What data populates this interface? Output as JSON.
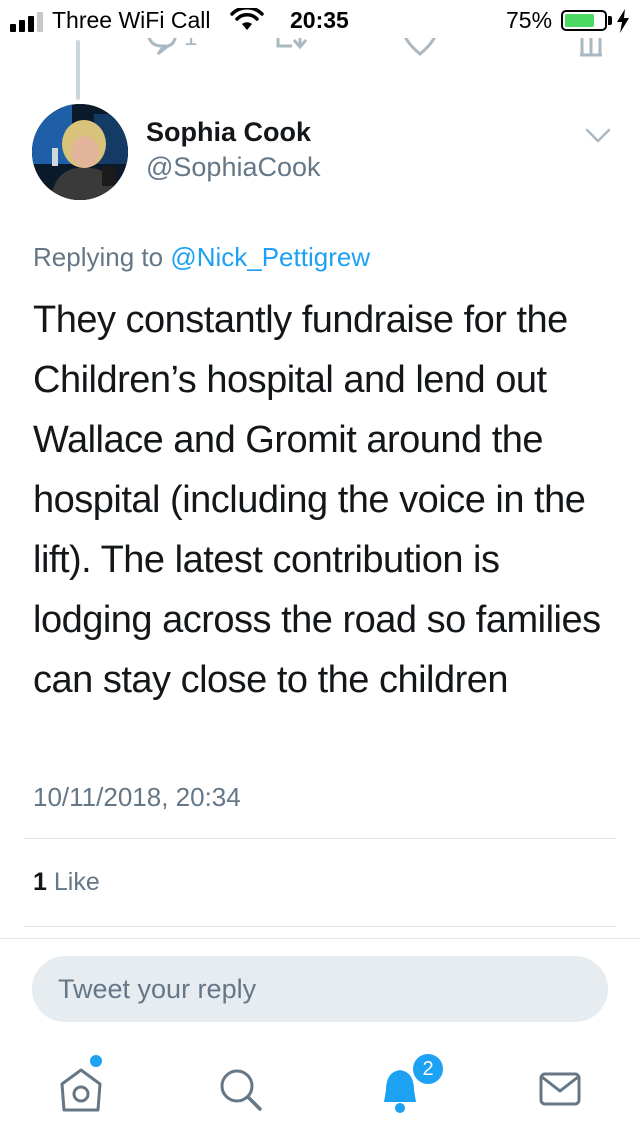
{
  "status_bar": {
    "carrier": "Three WiFi Call",
    "time": "20:35",
    "battery_percent": "75%",
    "battery_level": 0.75,
    "signal_bars": 3
  },
  "previous_tweet": {
    "reply_count": "1"
  },
  "tweet": {
    "author_name": "Sophia Cook",
    "author_handle": "@SophiaCook",
    "replying_prefix": "Replying to",
    "replying_to": "@Nick_Pettigrew",
    "text": "They constantly fundraise for the Children’s hospital and lend out Wallace and Gromit around the hospital (including the voice in the lift). The latest contribution is lodging across the road so families can stay close to the children",
    "timestamp": "10/11/2018, 20:34",
    "like_count": "1",
    "like_label": "Like"
  },
  "reply": {
    "placeholder": "Tweet your reply"
  },
  "tab_bar": {
    "notifications_badge": "2",
    "accent": "#1da1f2"
  }
}
